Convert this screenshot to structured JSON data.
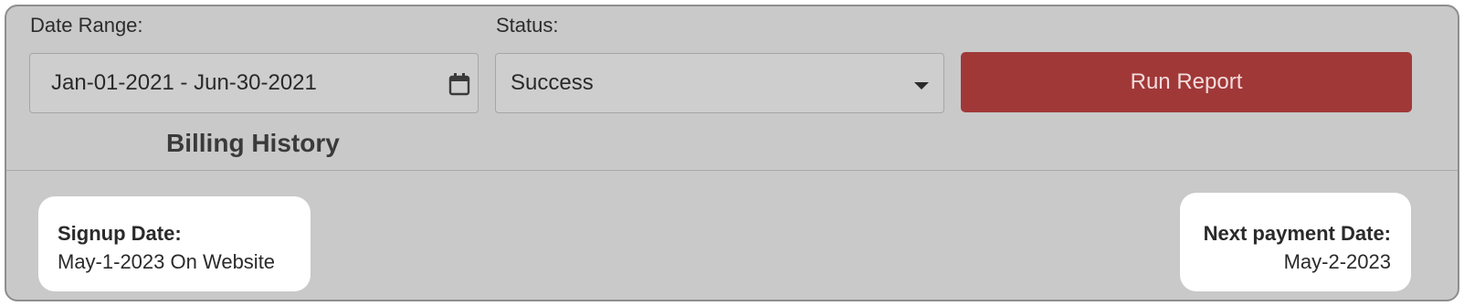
{
  "filters": {
    "date_range_label": "Date Range:",
    "date_range_value": "Jan-01-2021 - Jun-30-2021",
    "status_label": "Status:",
    "status_value": "Success"
  },
  "actions": {
    "run_report_label": "Run Report"
  },
  "section": {
    "title": "Billing History"
  },
  "signup": {
    "label": "Signup Date:",
    "value": "May-1-2023 On Website"
  },
  "next_payment": {
    "label": "Next payment Date:",
    "value": "May-2-2023"
  },
  "colors": {
    "panel_background": "#c9c9c9",
    "accent_button": "#a13838",
    "card_background": "#ffffff"
  },
  "icons": {
    "date_field": "calendar-icon",
    "status_field": "caret-down-icon"
  }
}
